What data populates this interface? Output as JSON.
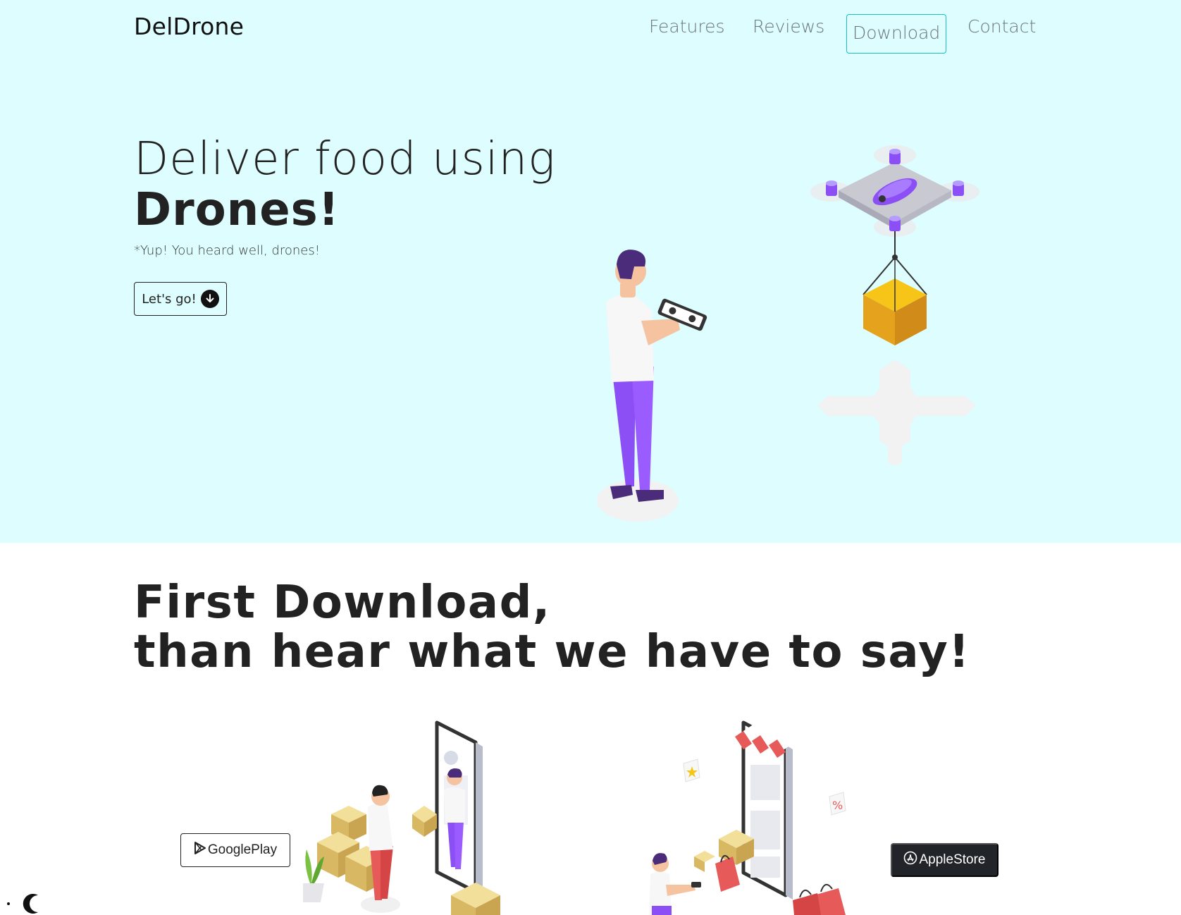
{
  "brand": "DelDrone",
  "nav": {
    "features": "Features",
    "reviews": "Reviews",
    "download": "Download",
    "contact": "Contact"
  },
  "hero": {
    "title_line1": "Deliver food using",
    "title_line2": "Drones!",
    "subtitle": "*Yup! You heard well, drones!",
    "cta_label": "Let's go!"
  },
  "download_section": {
    "title_line1": "First Download,",
    "title_line2": "than hear what we have to say!",
    "google_label": "GooglePlay",
    "apple_label": "AppleStore"
  },
  "colors": {
    "hero_bg": "#ddfdfe",
    "accent": "#17c3c8",
    "purple": "#8c4ff5",
    "dark": "#212529"
  },
  "icons": {
    "cta": "arrow-down-circle-icon",
    "google": "google-play-icon",
    "apple": "app-store-icon",
    "theme": "moon-icon"
  }
}
